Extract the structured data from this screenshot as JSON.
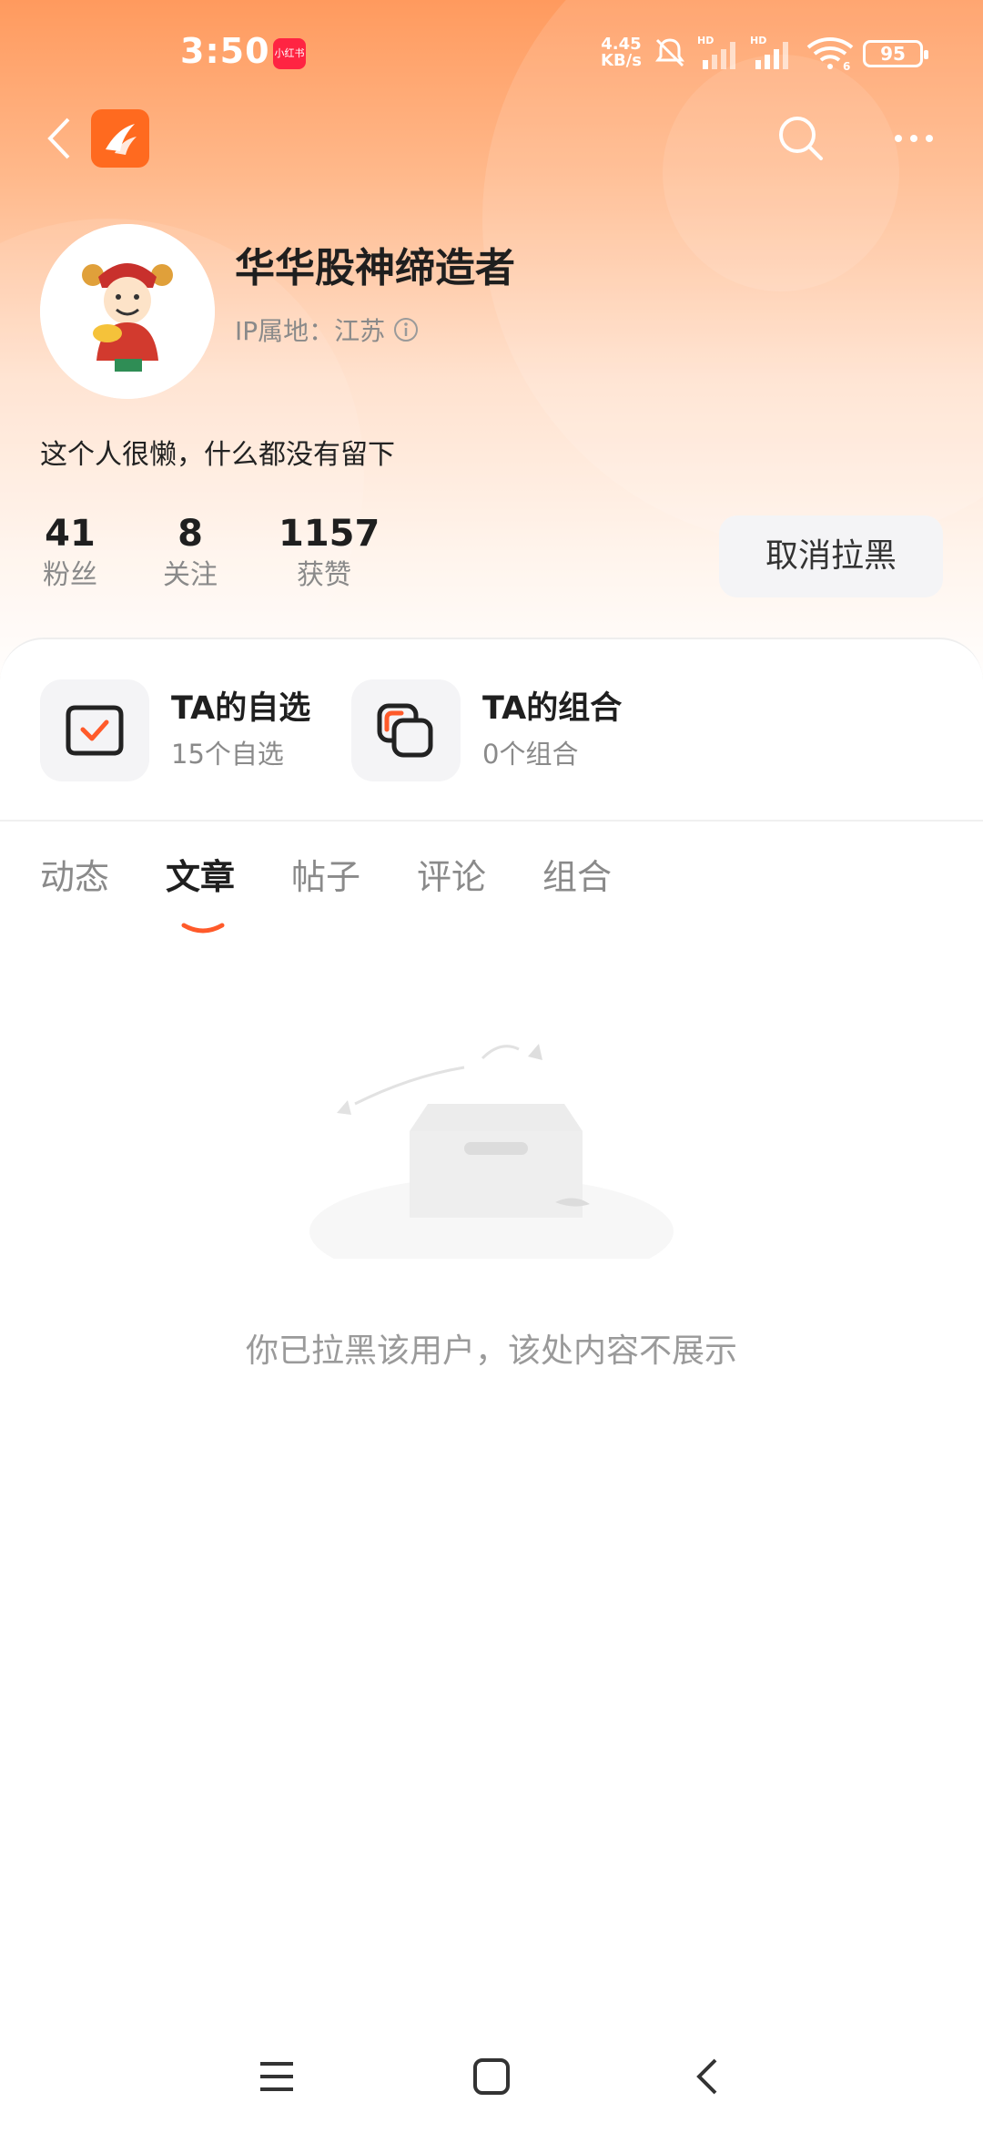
{
  "status_bar": {
    "time": "3:50",
    "app_badge": "小红书",
    "net_speed_value": "4.45",
    "net_speed_unit": "KB/s",
    "hd_label": "HD",
    "wifi_badge": "6",
    "battery": "95"
  },
  "nav": {
    "icons": [
      "back-arrow-icon",
      "app-logo-icon",
      "search-icon",
      "more-icon"
    ]
  },
  "profile": {
    "name": "华华股神缔造者",
    "ip_location": "IP属地：江苏",
    "bio": "这个人很懒，什么都没有留下"
  },
  "stats": [
    {
      "value": "41",
      "label": "粉丝"
    },
    {
      "value": "8",
      "label": "关注"
    },
    {
      "value": "1157",
      "label": "获赞"
    }
  ],
  "unblock_button": "取消拉黑",
  "entries": [
    {
      "title": "TA的自选",
      "sub": "15个自选",
      "icon": "checkbox-icon"
    },
    {
      "title": "TA的组合",
      "sub": "0个组合",
      "icon": "portfolio-icon"
    }
  ],
  "tabs": [
    {
      "label": "动态",
      "active": false
    },
    {
      "label": "文章",
      "active": true
    },
    {
      "label": "帖子",
      "active": false
    },
    {
      "label": "评论",
      "active": false
    },
    {
      "label": "组合",
      "active": false
    }
  ],
  "empty_state": {
    "message": "你已拉黑该用户，该处内容不展示",
    "icon": "empty-box-icon"
  },
  "colors": {
    "accent": "#ff6a1f",
    "header_gradient_top": "#ff9a5e"
  }
}
